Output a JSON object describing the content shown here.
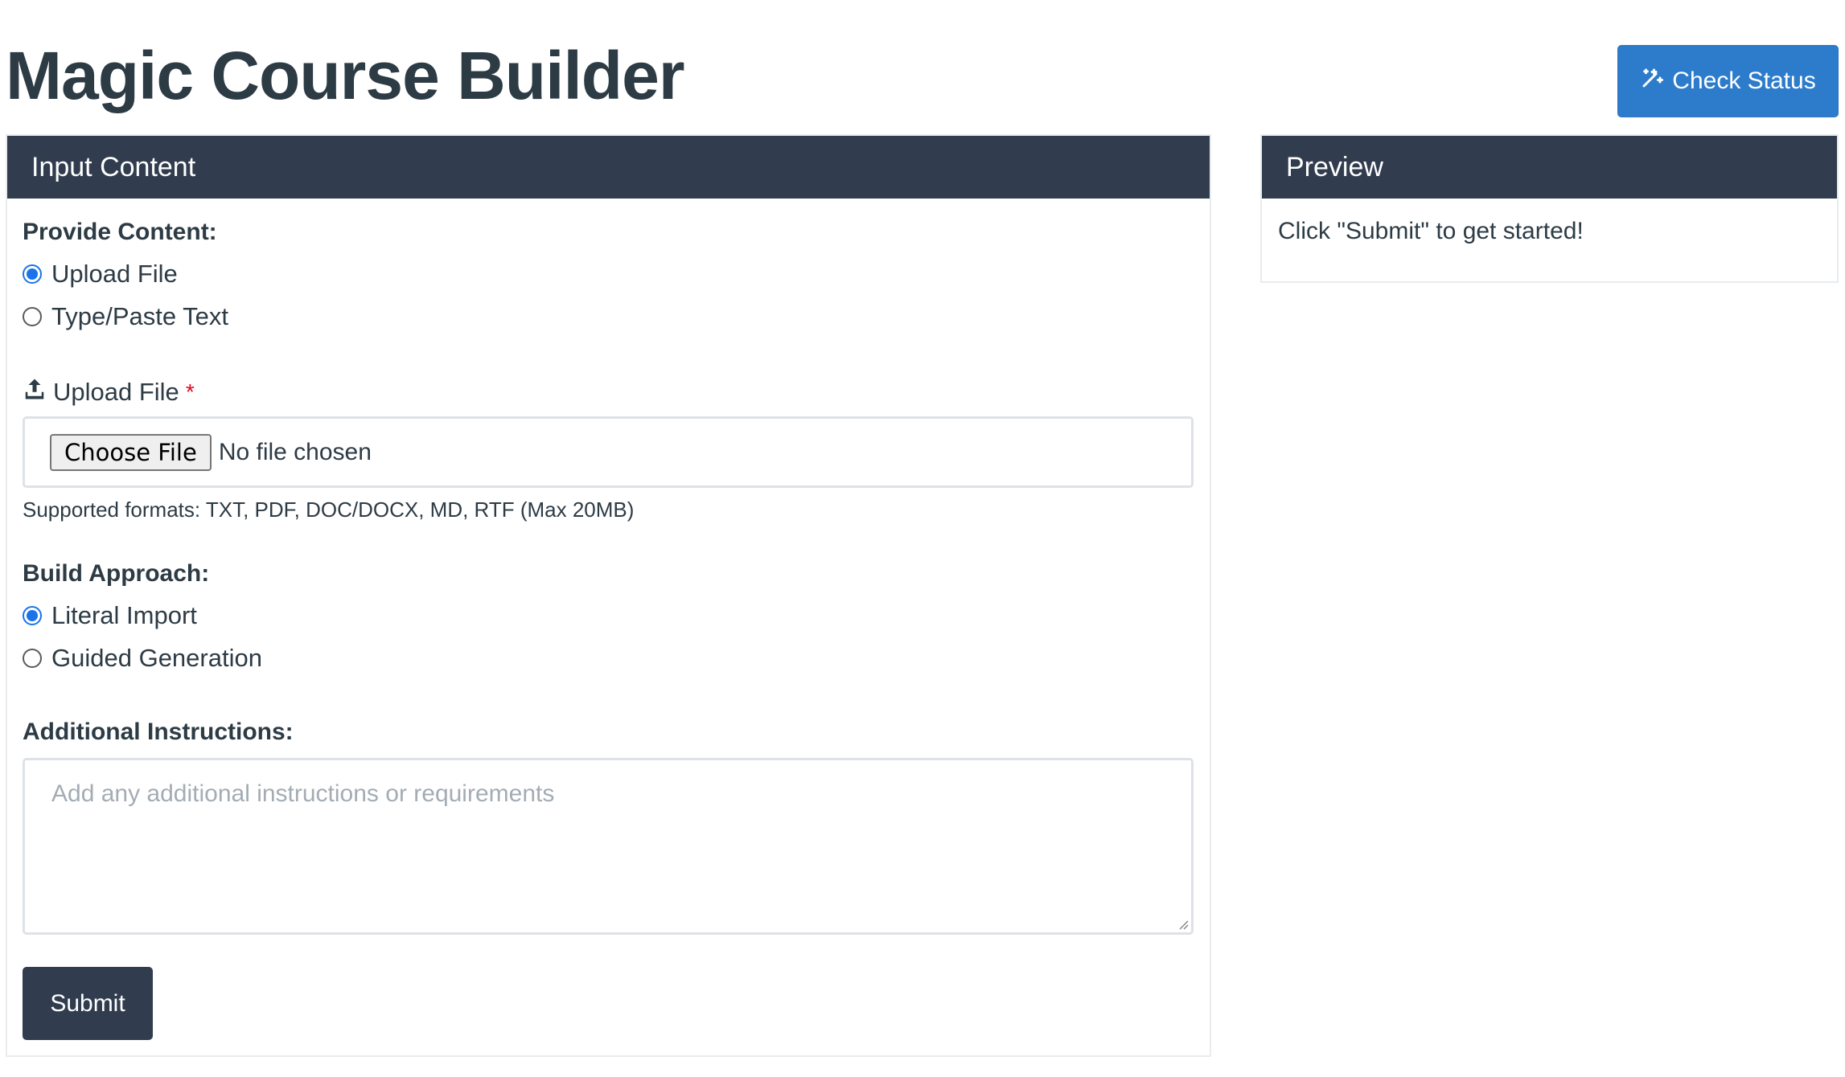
{
  "header": {
    "title": "Magic Course Builder",
    "check_status_label": "Check Status",
    "check_status_icon": "magic-wand-icon"
  },
  "input_panel": {
    "title": "Input Content",
    "provide_content": {
      "label": "Provide Content:",
      "options": [
        {
          "label": "Upload File",
          "checked": true
        },
        {
          "label": "Type/Paste Text",
          "checked": false
        }
      ]
    },
    "upload": {
      "label": "Upload File",
      "required_mark": "*",
      "icon": "upload-icon",
      "choose_label": "Choose File",
      "status": "No file chosen",
      "hint": "Supported formats: TXT, PDF, DOC/DOCX, MD, RTF (Max 20MB)"
    },
    "build_approach": {
      "label": "Build Approach:",
      "options": [
        {
          "label": "Literal Import",
          "checked": true
        },
        {
          "label": "Guided Generation",
          "checked": false
        }
      ]
    },
    "instructions": {
      "label": "Additional Instructions:",
      "placeholder": "Add any additional instructions or requirements"
    },
    "submit_label": "Submit"
  },
  "preview_panel": {
    "title": "Preview",
    "message": "Click \"Submit\" to get started!"
  },
  "colors": {
    "primary": "#313d4f",
    "accent": "#2d7ccb",
    "radio_checked": "#1a73e8",
    "required": "#e0061f"
  }
}
